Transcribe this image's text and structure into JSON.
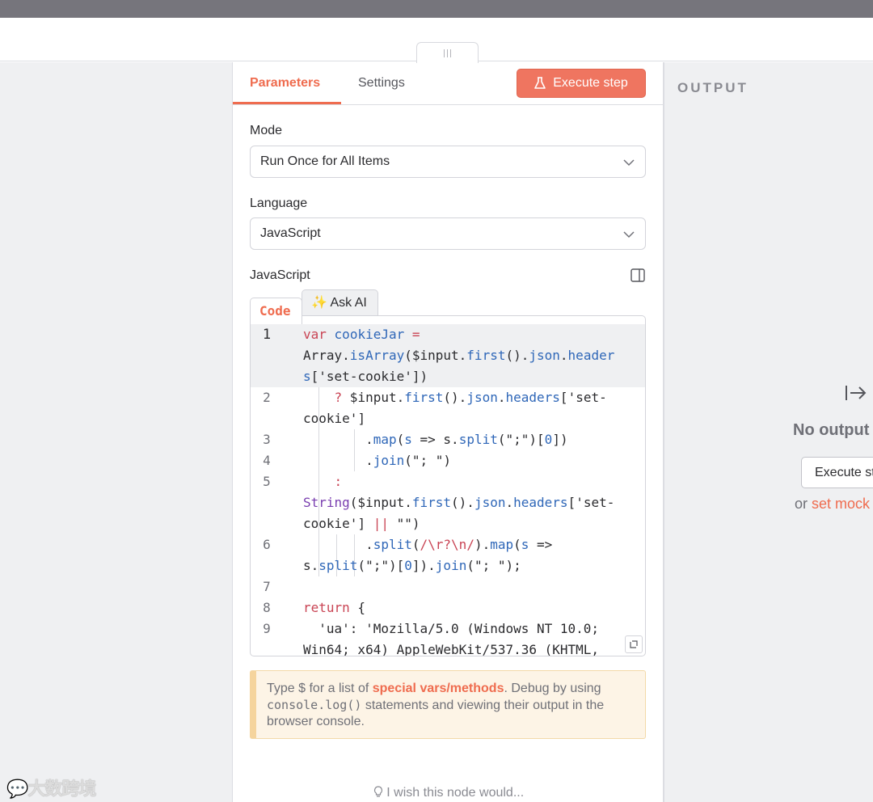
{
  "tabs": {
    "parameters": "Parameters",
    "settings": "Settings"
  },
  "execute_step": "Execute step",
  "mode": {
    "label": "Mode",
    "value": "Run Once for All Items"
  },
  "language": {
    "label": "Language",
    "value": "JavaScript"
  },
  "code_section_label": "JavaScript",
  "code_tabs": {
    "code": "Code",
    "ask_ai": "✨ Ask AI"
  },
  "code_lines": [
    {
      "n": "1",
      "text": "var cookieJar ="
    },
    {
      "n": "",
      "text": "Array.isArray($input.first().json.header"
    },
    {
      "n": "",
      "text": "s['set-cookie'])"
    },
    {
      "n": "2",
      "text": "    ? $input.first().json.headers['set-"
    },
    {
      "n": "",
      "text": "cookie']"
    },
    {
      "n": "3",
      "text": "        .map(s => s.split(\";\")[0])"
    },
    {
      "n": "4",
      "text": "        .join(\"; \")"
    },
    {
      "n": "5",
      "text": "    :"
    },
    {
      "n": "",
      "text": "String($input.first().json.headers['set-"
    },
    {
      "n": "",
      "text": "cookie'] || \"\")"
    },
    {
      "n": "6",
      "text": "        .split(/\\r?\\n/).map(s =>"
    },
    {
      "n": "",
      "text": "s.split(\";\")[0]).join(\"; \");"
    },
    {
      "n": "7",
      "text": ""
    },
    {
      "n": "8",
      "text": "return {"
    },
    {
      "n": "9",
      "text": "  'ua': 'Mozilla/5.0 (Windows NT 10.0;"
    },
    {
      "n": "",
      "text": "Win64; x64) AppleWebKit/537.36 (KHTML,"
    }
  ],
  "hint": {
    "prefix": "Type $ for a list of ",
    "link": "special vars/methods",
    "middle": ". Debug by using ",
    "code": "console.log()",
    "suffix": " statements and viewing their output in the browser console."
  },
  "wish": "I wish this node would...",
  "output": {
    "title": "OUTPUT",
    "no_output": "No output",
    "execute_button": "Execute step",
    "or": "or ",
    "set_mock": "set mock data"
  },
  "watermark": "大数跨境",
  "colors": {
    "accent": "#ef6c4f",
    "button": "#ef7560",
    "pane_bg": "#eff0f2"
  }
}
